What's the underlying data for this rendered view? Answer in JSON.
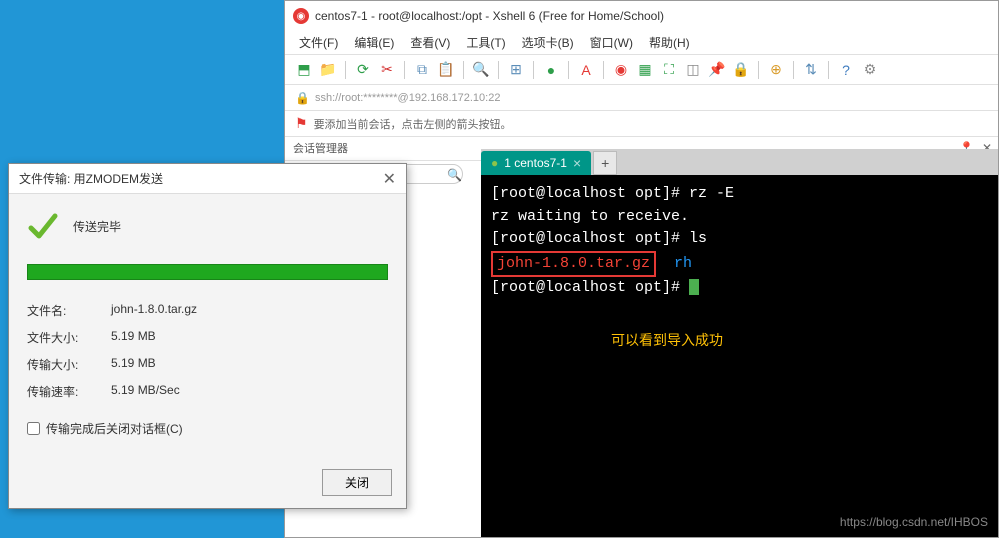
{
  "xshell": {
    "title": "centos7-1 - root@localhost:/opt - Xshell 6 (Free for Home/School)",
    "menu": [
      "文件(F)",
      "编辑(E)",
      "查看(V)",
      "工具(T)",
      "选项卡(B)",
      "窗口(W)",
      "帮助(H)"
    ],
    "connection": "ssh://root:********@192.168.172.10:22",
    "hint": "要添加当前会话，点击左侧的箭头按钮。",
    "session_panel": "会话管理器",
    "search_placeholder": ""
  },
  "terminal": {
    "tab_label": "1 centos7-1",
    "lines": {
      "l1_prompt": "[root@localhost opt]# ",
      "l1_cmd": "rz -E",
      "l2": "rz waiting to receive.",
      "l3_prompt": "[root@localhost opt]# ",
      "l3_cmd": "ls",
      "l4_file": "john-1.8.0.tar.gz",
      "l4_dir": "rh",
      "l5_prompt": "[root@localhost opt]# "
    },
    "annotation": "可以看到导入成功",
    "watermark": "https://blog.csdn.net/IHBOS"
  },
  "dialog": {
    "title": "文件传输: 用ZMODEM发送",
    "status": "传送完毕",
    "info": {
      "filename_label": "文件名:",
      "filename": "john-1.8.0.tar.gz",
      "filesize_label": "文件大小:",
      "filesize": "5.19 MB",
      "transfersize_label": "传输大小:",
      "transfersize": "5.19 MB",
      "speed_label": "传输速率:",
      "speed": "5.19 MB/Sec"
    },
    "checkbox": "传输完成后关闭对话框(C)",
    "close_btn": "关闭"
  }
}
